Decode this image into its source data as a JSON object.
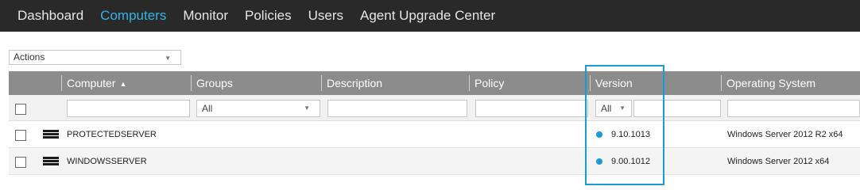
{
  "nav": {
    "items": [
      {
        "label": "Dashboard"
      },
      {
        "label": "Computers"
      },
      {
        "label": "Monitor"
      },
      {
        "label": "Policies"
      },
      {
        "label": "Users"
      },
      {
        "label": "Agent Upgrade Center"
      }
    ],
    "active": "Computers"
  },
  "actions": {
    "label": "Actions"
  },
  "grid": {
    "columns": [
      {
        "label": "Computer"
      },
      {
        "label": "Groups"
      },
      {
        "label": "Description"
      },
      {
        "label": "Policy"
      },
      {
        "label": "Version"
      },
      {
        "label": "Operating System"
      }
    ],
    "sort_column": "Computer",
    "sort_direction": "ascending",
    "filters": {
      "computer": "",
      "groups": "All",
      "description": "",
      "policy": "",
      "version_select": "All",
      "version_text": "",
      "os": ""
    },
    "rows": [
      {
        "computer": "PROTECTEDSERVER",
        "version": "9.10.1013",
        "os": "Windows Server 2012 R2 x64",
        "checked": false
      },
      {
        "computer": "WINDOWSSERVER",
        "version": "9.00.1012",
        "os": "Windows Server 2012 x64",
        "checked": false
      }
    ]
  },
  "colors": {
    "nav_bg": "#292929",
    "nav_active": "#33b5e5",
    "header_bg": "#8c8c8c",
    "status_dot": "#1a9ad6",
    "highlight": "#1a9ad6"
  },
  "icons": {
    "sort": "sort-ascending-icon",
    "server": "server-icon",
    "status": "status-dot-icon",
    "dropdown": "chevron-down-icon"
  }
}
